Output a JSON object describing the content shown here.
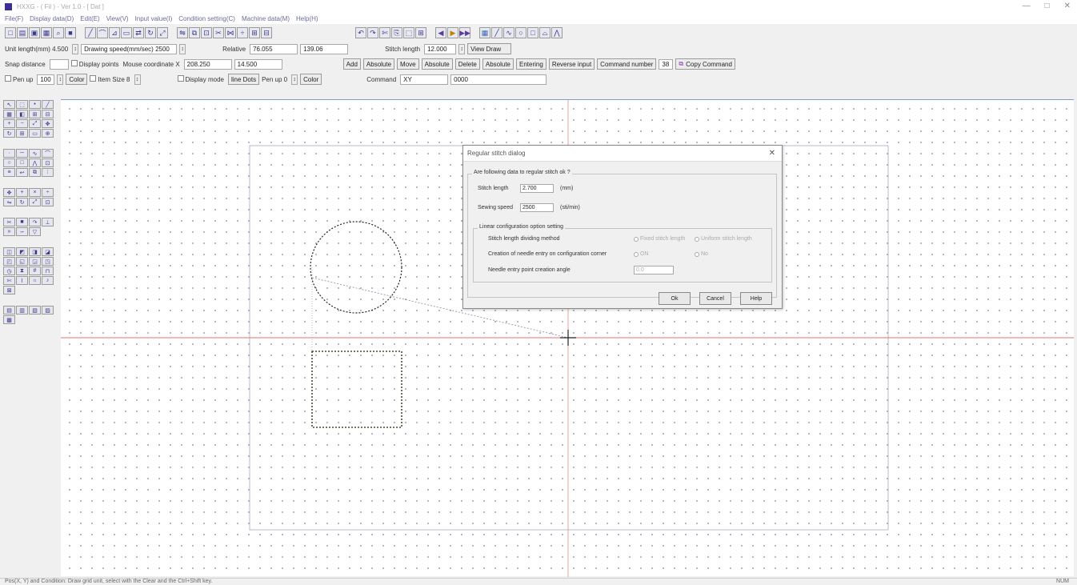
{
  "titlebar": {
    "title": "HXXG - ( Fil ) - Ver 1.0 - [ Dat ]",
    "minimize": "—",
    "maximize": "□",
    "close": "✕"
  },
  "menu": [
    "File(F)",
    "Display data(D)",
    "Edit(E)",
    "View(V)",
    "Input value(I)",
    "Condition setting(C)",
    "Machine data(M)",
    "Help(H)"
  ],
  "toolbar2": {
    "unit_length_label": "Unit length(mm) 4.500",
    "drawing_speed_label": "Drawing speed(mm/sec) 2500",
    "relative_label": "Relative",
    "x_value": "76.055",
    "y_value": "139.06",
    "stitch_length_label": "Stitch length",
    "stitch_length_value": "12.000",
    "view_draw": "View Draw"
  },
  "toolbar3": {
    "snap_label": "Snap distance",
    "display_points": "Display points",
    "mouse_coordinate_label": "Mouse coordinate X",
    "mouse_x": "208.250",
    "mouse_y": "14.500",
    "add": "Add",
    "absolute1": "Absolute",
    "move": "Move",
    "absolute2": "Absolute",
    "delete": "Delete",
    "absolute3": "Absolute",
    "entering": "Entering",
    "reverse_input": "Reverse input",
    "command_number": "Command number",
    "command_value": "38",
    "copy_command": "Copy Command"
  },
  "toolbar4": {
    "pen_up_label": "Pen up",
    "pen_up_value": "100",
    "color1": "Color",
    "item_size": "Item Size 8",
    "display_mode": "Display mode",
    "line_dots": "line Dots",
    "pen_up2": "Pen up 0",
    "color2": "Color",
    "command_label": "Command",
    "command_value": "XY",
    "extra_value": "0000"
  },
  "dialog": {
    "title": "Regular stitch dialog",
    "group1_title": "Are following data to regular stitch ok ?",
    "stitch_length_label": "Stitch length",
    "stitch_length_value": "2.700",
    "stitch_length_unit": "(mm)",
    "sewing_speed_label": "Sewing speed",
    "sewing_speed_value": "2500",
    "sewing_speed_unit": "(sti/min)",
    "group2_title": "Linear configuration option setting",
    "row1_label": "Stitch length dividing method",
    "row1_opt1": "Fixed stitch length",
    "row1_opt2": "Uniform stitch length",
    "row2_label": "Creation of needle entry on configuration corner",
    "row2_opt1": "ON",
    "row2_opt2": "No",
    "row3_label": "Needle entry point creation angle",
    "row3_value": "0.0",
    "ok": "Ok",
    "cancel": "Cancel",
    "help": "Help"
  },
  "status": {
    "left": "Pos(X, Y) and Condition: Draw grid unit, select with the Clear and the Ctrl+Shift key.",
    "right": "NUM"
  }
}
